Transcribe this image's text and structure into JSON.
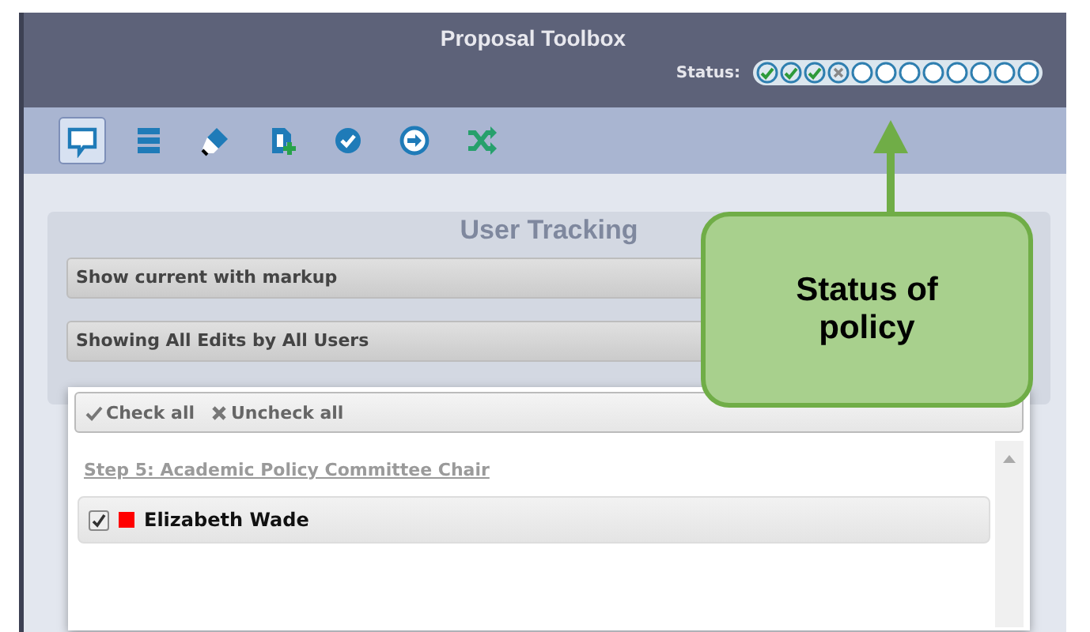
{
  "window": {
    "title": "Proposal Toolbox"
  },
  "status": {
    "label": "Status:",
    "steps": [
      {
        "kind": "done"
      },
      {
        "kind": "done"
      },
      {
        "kind": "done"
      },
      {
        "kind": "rejected"
      },
      {
        "kind": "pending"
      },
      {
        "kind": "pending"
      },
      {
        "kind": "pending"
      },
      {
        "kind": "pending"
      },
      {
        "kind": "pending"
      },
      {
        "kind": "pending"
      },
      {
        "kind": "pending"
      },
      {
        "kind": "pending"
      }
    ]
  },
  "toolbar": [
    {
      "selected": true
    },
    {
      "selected": false
    },
    {
      "selected": false
    },
    {
      "selected": false
    },
    {
      "selected": false
    },
    {
      "selected": false
    },
    {
      "selected": false
    }
  ],
  "panel": {
    "title": "User Tracking",
    "dropdowns": [
      "Show current with markup",
      "Showing All Edits by All Users"
    ]
  },
  "dropdown_list": {
    "actions": [
      {
        "kind": "check",
        "label": "Check all"
      },
      {
        "kind": "uncheck",
        "label": "Uncheck all"
      }
    ],
    "groups": [
      {
        "heading": "Step 5: Academic Policy Committee Chair",
        "users": [
          {
            "name": "Elizabeth Wade",
            "checked": true,
            "color": "#ff0000"
          }
        ]
      }
    ]
  },
  "callout": {
    "text": "Status of policy"
  }
}
